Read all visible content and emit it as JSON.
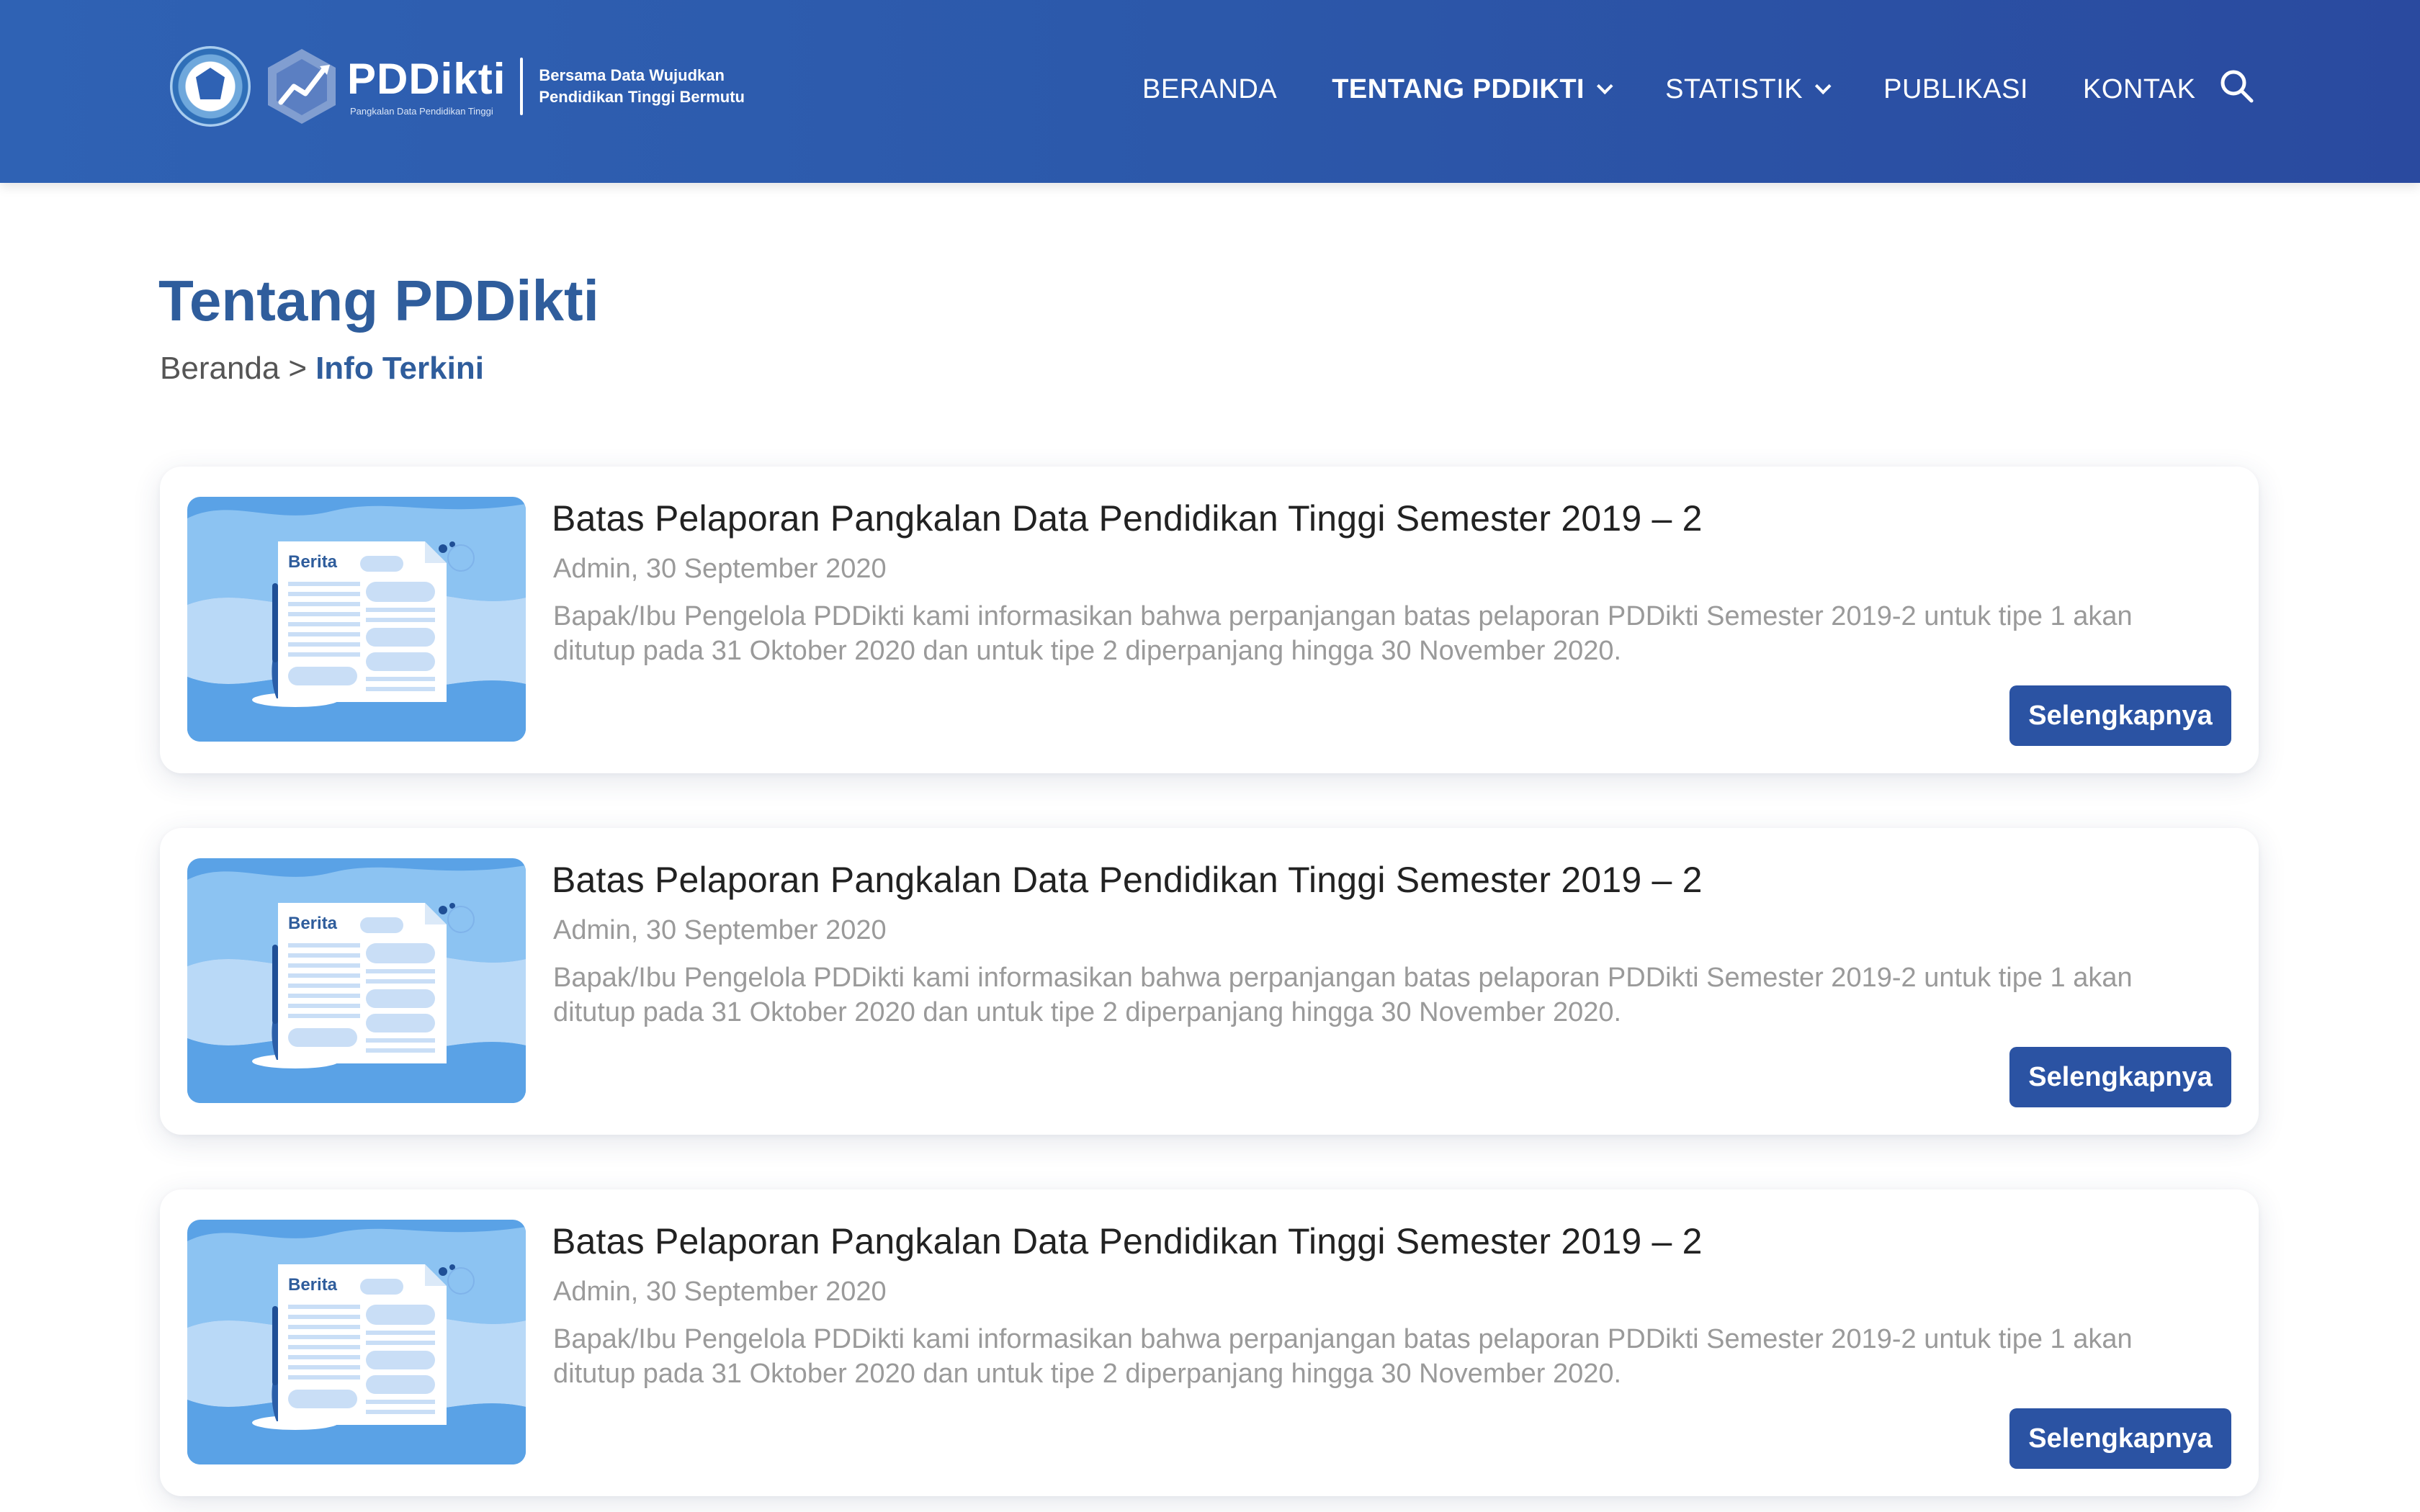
{
  "header": {
    "logo_name": "PDDikti",
    "logo_subtitle": "Pangkalan Data Pendidikan Tinggi",
    "tagline_line1": "Bersama Data Wujudkan",
    "tagline_line2": "Pendidikan Tinggi Bermutu",
    "nav": [
      {
        "label": "BERANDA",
        "active": false,
        "dropdown": false
      },
      {
        "label": "TENTANG PDDIKTI",
        "active": true,
        "dropdown": true
      },
      {
        "label": "STATISTIK",
        "active": false,
        "dropdown": true
      },
      {
        "label": "PUBLIKASI",
        "active": false,
        "dropdown": false
      },
      {
        "label": "KONTAK",
        "active": false,
        "dropdown": false
      }
    ],
    "search_icon": "search-icon"
  },
  "page": {
    "title": "Tentang PDDikti",
    "breadcrumb": {
      "home": "Beranda",
      "separator": ">",
      "current": "Info Terkini"
    }
  },
  "cards": [
    {
      "thumb_label": "Berita",
      "title": "Batas Pelaporan Pangkalan Data Pendidikan Tinggi Semester 2019 – 2",
      "meta": "Admin, 30 September 2020",
      "excerpt": "Bapak/Ibu Pengelola PDDikti kami informasikan bahwa perpanjangan batas pelaporan PDDikti Semester 2019-2 untuk tipe 1 akan ditutup pada 31 Oktober 2020 dan untuk tipe 2 diperpanjang hingga 30 November 2020.",
      "button": "Selengkapnya"
    },
    {
      "thumb_label": "Berita",
      "title": "Batas Pelaporan Pangkalan Data Pendidikan Tinggi Semester 2019 – 2",
      "meta": "Admin, 30 September 2020",
      "excerpt": "Bapak/Ibu Pengelola PDDikti kami informasikan bahwa perpanjangan batas pelaporan PDDikti Semester 2019-2 untuk tipe 1 akan ditutup pada 31 Oktober 2020 dan untuk tipe 2 diperpanjang hingga 30 November 2020.",
      "button": "Selengkapnya"
    },
    {
      "thumb_label": "Berita",
      "title": "Batas Pelaporan Pangkalan Data Pendidikan Tinggi Semester 2019 – 2",
      "meta": "Admin, 30 September 2020",
      "excerpt": "Bapak/Ibu Pengelola PDDikti kami informasikan bahwa perpanjangan batas pelaporan PDDikti Semester 2019-2 untuk tipe 1 akan ditutup pada 31 Oktober 2020 dan untuk tipe 2 diperpanjang hingga 30 November 2020.",
      "button": "Selengkapnya"
    }
  ],
  "colors": {
    "header_start": "#2f62b4",
    "header_end": "#2a4a9f",
    "title_blue": "#2f5d9c",
    "button_blue": "#2b53a3",
    "muted_text": "#9a9a9a"
  }
}
